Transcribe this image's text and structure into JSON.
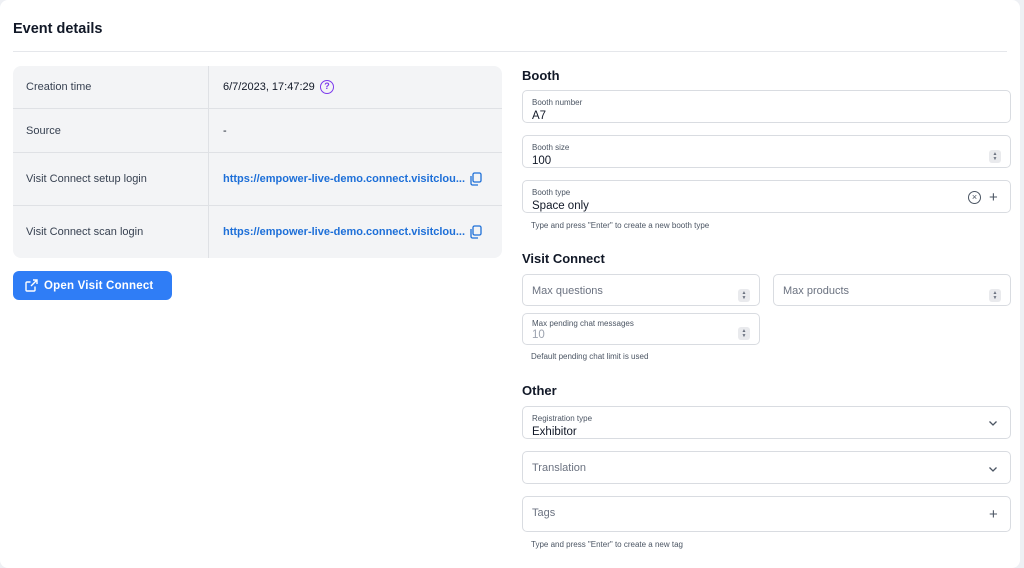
{
  "page": {
    "title": "Event details"
  },
  "info": {
    "rows": [
      {
        "label": "Creation time",
        "value": "6/7/2023, 17:47:29"
      },
      {
        "label": "Source",
        "value": "-"
      },
      {
        "label": "Visit Connect setup login",
        "value": "https://empower-live-demo.connect.visitclou..."
      },
      {
        "label": "Visit Connect scan login",
        "value": "https://empower-live-demo.connect.visitclou..."
      }
    ],
    "help_glyph": "?"
  },
  "open_button": {
    "label": "Open Visit Connect"
  },
  "booth": {
    "heading": "Booth",
    "number": {
      "label": "Booth number",
      "value": "A7"
    },
    "size": {
      "label": "Booth size",
      "value": "100"
    },
    "type": {
      "label": "Booth type",
      "value": "Space only",
      "helper": "Type and press \"Enter\" to create a new booth type"
    }
  },
  "visit_connect": {
    "heading": "Visit Connect",
    "max_questions": {
      "placeholder": "Max questions"
    },
    "max_products": {
      "placeholder": "Max products"
    },
    "max_pending": {
      "label": "Max pending chat messages",
      "value": "10",
      "helper": "Default pending chat limit is used"
    }
  },
  "other": {
    "heading": "Other",
    "registration_type": {
      "label": "Registration type",
      "value": "Exhibitor"
    },
    "translation": {
      "placeholder": "Translation"
    },
    "tags": {
      "placeholder": "Tags",
      "helper": "Type and press \"Enter\" to create a new tag"
    }
  },
  "icons": {
    "plus": "+",
    "clear": "×",
    "stepper_up": "▲",
    "stepper_down": "▼"
  },
  "colors": {
    "accent": "#2f7df6",
    "link": "#1d6fd8",
    "help": "#7c3aed"
  }
}
